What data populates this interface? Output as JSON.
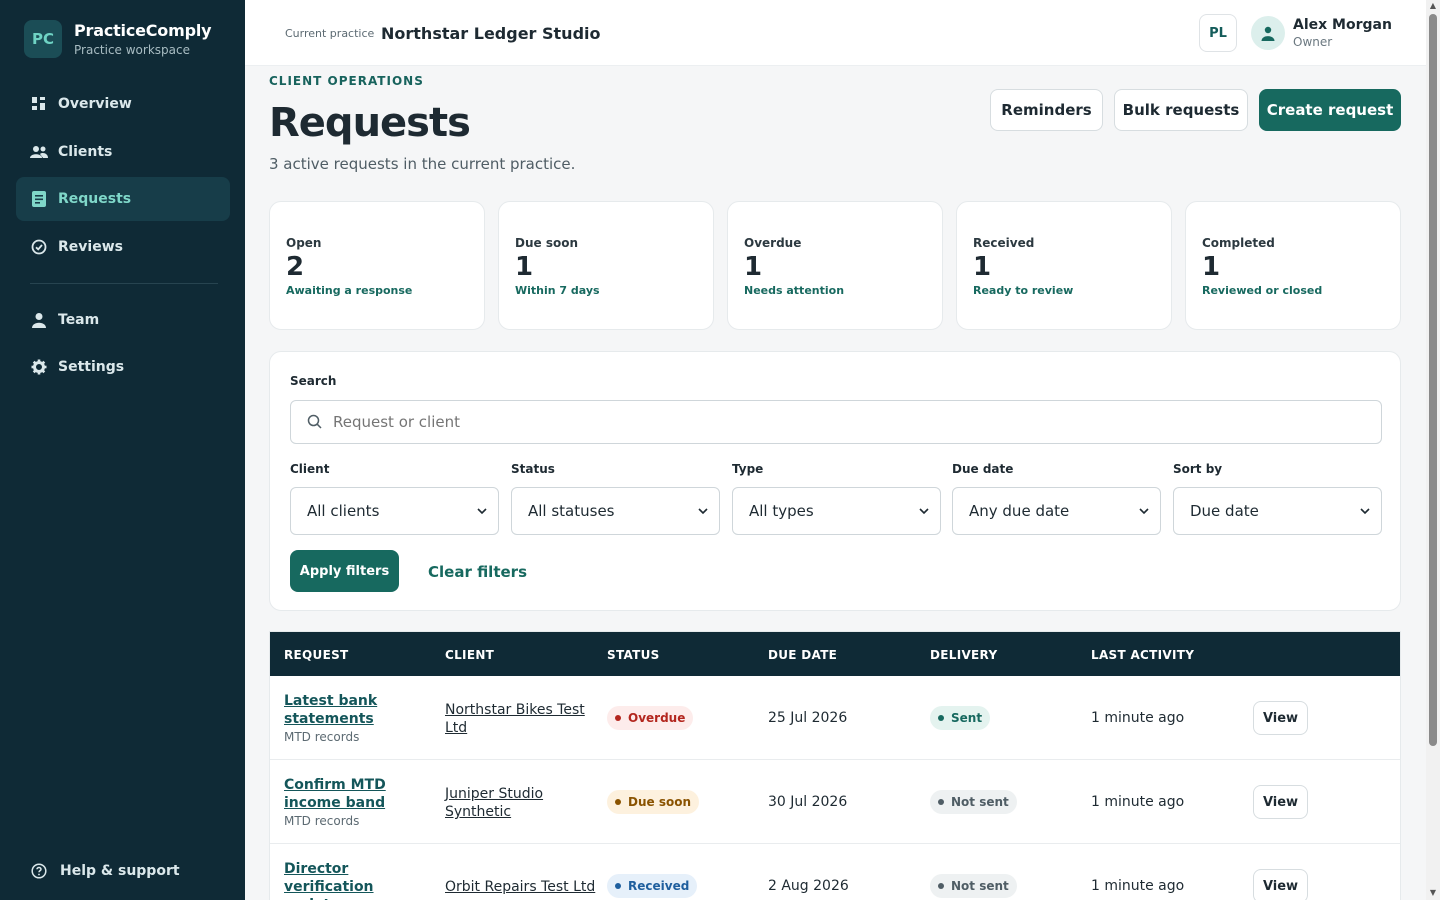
{
  "brand": {
    "logo": "PC",
    "name": "PracticeComply",
    "sub": "Practice workspace"
  },
  "nav": {
    "overview": "Overview",
    "clients": "Clients",
    "requests": "Requests",
    "reviews": "Reviews",
    "team": "Team",
    "settings": "Settings",
    "help": "Help & support"
  },
  "topbar": {
    "current_practice_label": "Current practice",
    "current_practice_name": "Northstar Ledger Studio",
    "practice_badge": "PL",
    "user_name": "Alex Morgan",
    "user_role": "Owner"
  },
  "header": {
    "eyebrow": "CLIENT OPERATIONS",
    "title": "Requests",
    "subtitle": "3 active requests in the current practice.",
    "reminders": "Reminders",
    "bulk": "Bulk requests",
    "create": "Create request"
  },
  "stats": [
    {
      "label": "Open",
      "value": "2",
      "note": "Awaiting a response"
    },
    {
      "label": "Due soon",
      "value": "1",
      "note": "Within 7 days"
    },
    {
      "label": "Overdue",
      "value": "1",
      "note": "Needs attention"
    },
    {
      "label": "Received",
      "value": "1",
      "note": "Ready to review"
    },
    {
      "label": "Completed",
      "value": "1",
      "note": "Reviewed or closed"
    }
  ],
  "filters": {
    "search_label": "Search",
    "search_placeholder": "Request or client",
    "client_label": "Client",
    "client_value": "All clients",
    "status_label": "Status",
    "status_value": "All statuses",
    "type_label": "Type",
    "type_value": "All types",
    "due_label": "Due date",
    "due_value": "Any due date",
    "sort_label": "Sort by",
    "sort_value": "Due date",
    "apply": "Apply filters",
    "clear": "Clear filters"
  },
  "table": {
    "headers": [
      "REQUEST",
      "CLIENT",
      "STATUS",
      "DUE DATE",
      "DELIVERY",
      "LAST ACTIVITY"
    ],
    "view_label": "View",
    "rows": [
      {
        "title": "Latest bank statements",
        "type": "MTD records",
        "client": "Northstar Bikes Test Ltd",
        "status": "Overdue",
        "status_color": "#b3261e",
        "status_bg": "#fdeceb",
        "due": "25 Jul 2026",
        "delivery": "Sent",
        "delivery_color": "#17695f",
        "delivery_bg": "#e4f3ef",
        "activity": "1 minute ago"
      },
      {
        "title": "Confirm MTD income band",
        "type": "MTD records",
        "client": "Juniper Studio Synthetic",
        "status": "Due soon",
        "status_color": "#8a5300",
        "status_bg": "#fdf1de",
        "due": "30 Jul 2026",
        "delivery": "Not sent",
        "delivery_color": "#4f5d65",
        "delivery_bg": "#eef1f2",
        "activity": "1 minute ago"
      },
      {
        "title": "Director verification update",
        "type": "",
        "client": "Orbit Repairs Test Ltd",
        "status": "Received",
        "status_color": "#1f5f9e",
        "status_bg": "#e6f0fa",
        "due": "2 Aug 2026",
        "delivery": "Not sent",
        "delivery_color": "#4f5d65",
        "delivery_bg": "#eef1f2",
        "activity": "1 minute ago"
      }
    ]
  }
}
